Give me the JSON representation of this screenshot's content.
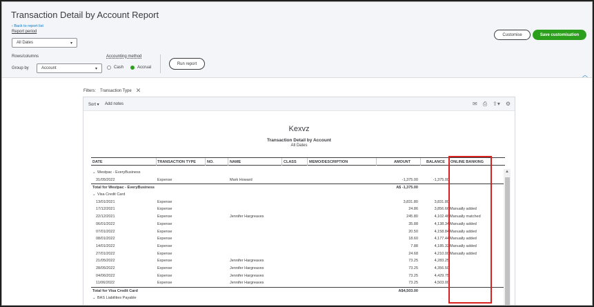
{
  "header": {
    "title": "Transaction Detail by Account Report",
    "back_link": "Back to report list",
    "report_period_label": "Report period",
    "report_period_value": "All Dates",
    "rows_columns_label": "Rows/columns",
    "group_by_label": "Group by",
    "group_by_value": "Account",
    "accounting_method_label": "Accounting method",
    "cash_label": "Cash",
    "accrual_label": "Accrual",
    "run_report": "Run report",
    "customise": "Customise",
    "save_customisation": "Save customisation"
  },
  "filters": {
    "label": "Filters:",
    "chip": "Transaction Type"
  },
  "toolbar": {
    "sort": "Sort ▾",
    "add_notes": "Add notes"
  },
  "report": {
    "company": "Kexvz",
    "title": "Transaction Detail by Account",
    "subtitle": "All Dates",
    "columns": {
      "date": "DATE",
      "type": "TRANSACTION TYPE",
      "no": "NO.",
      "name": "NAME",
      "class": "CLASS",
      "memo": "MEMO/DESCRIPTION",
      "amount": "AMOUNT",
      "balance": "BALANCE",
      "online": "ONLINE BANKING"
    },
    "rows": [
      {
        "kind": "group",
        "label": "Westpac - EveryBusiness"
      },
      {
        "kind": "txn",
        "date": "31/05/2022",
        "type": "Expense",
        "name": "Mark Howard",
        "amount": "-1,375.00",
        "balance": "-1,375.00",
        "online": ""
      },
      {
        "kind": "total",
        "label": "Total for Westpac - EveryBusiness",
        "amount": "A$ -1,375.00"
      },
      {
        "kind": "group",
        "label": "Visa Credit Card"
      },
      {
        "kind": "txn",
        "date": "13/01/2021",
        "type": "Expense",
        "name": "",
        "amount": "3,831.80",
        "balance": "3,831.80",
        "online": ""
      },
      {
        "kind": "txn",
        "date": "17/12/2021",
        "type": "Expense",
        "name": "",
        "amount": "24.86",
        "balance": "3,856.66",
        "online": "Manually added"
      },
      {
        "kind": "txn",
        "date": "22/12/2021",
        "type": "Expense",
        "name": "Jennifer Hargreaves",
        "amount": "245.80",
        "balance": "4,102.46",
        "online": "Manually matched"
      },
      {
        "kind": "txn",
        "date": "06/01/2022",
        "type": "Expense",
        "name": "",
        "amount": "35.88",
        "balance": "4,138.34",
        "online": "Manually added"
      },
      {
        "kind": "txn",
        "date": "07/01/2022",
        "type": "Expense",
        "name": "",
        "amount": "20.50",
        "balance": "4,158.84",
        "online": "Manually added"
      },
      {
        "kind": "txn",
        "date": "08/01/2022",
        "type": "Expense",
        "name": "",
        "amount": "18.60",
        "balance": "4,177.44",
        "online": "Manually added"
      },
      {
        "kind": "txn",
        "date": "14/01/2022",
        "type": "Expense",
        "name": "",
        "amount": "7.88",
        "balance": "4,185.32",
        "online": "Manually added"
      },
      {
        "kind": "txn",
        "date": "27/01/2022",
        "type": "Expense",
        "name": "",
        "amount": "24.68",
        "balance": "4,210.00",
        "online": "Manually added"
      },
      {
        "kind": "txn",
        "date": "21/05/2022",
        "type": "Expense",
        "name": "Jennifer Hargreaves",
        "amount": "73.25",
        "balance": "4,283.25",
        "online": ""
      },
      {
        "kind": "txn",
        "date": "28/05/2022",
        "type": "Expense",
        "name": "Jennifer Hargreaves",
        "amount": "73.25",
        "balance": "4,356.50",
        "online": ""
      },
      {
        "kind": "txn",
        "date": "04/06/2022",
        "type": "Expense",
        "name": "Jennifer Hargreaves",
        "amount": "73.25",
        "balance": "4,429.75",
        "online": ""
      },
      {
        "kind": "txn",
        "date": "11/06/2022",
        "type": "Expense",
        "name": "Jennifer Hargreaves",
        "amount": "73.25",
        "balance": "4,503.00",
        "online": ""
      },
      {
        "kind": "total",
        "label": "Total for Visa Credit Card",
        "amount": "A$4,503.00"
      },
      {
        "kind": "group",
        "label": "BAS Liabilities Payable"
      }
    ]
  },
  "colors": {
    "accent_green": "#2ca01c",
    "highlight_red": "#d9201e",
    "link_blue": "#0077c5"
  }
}
